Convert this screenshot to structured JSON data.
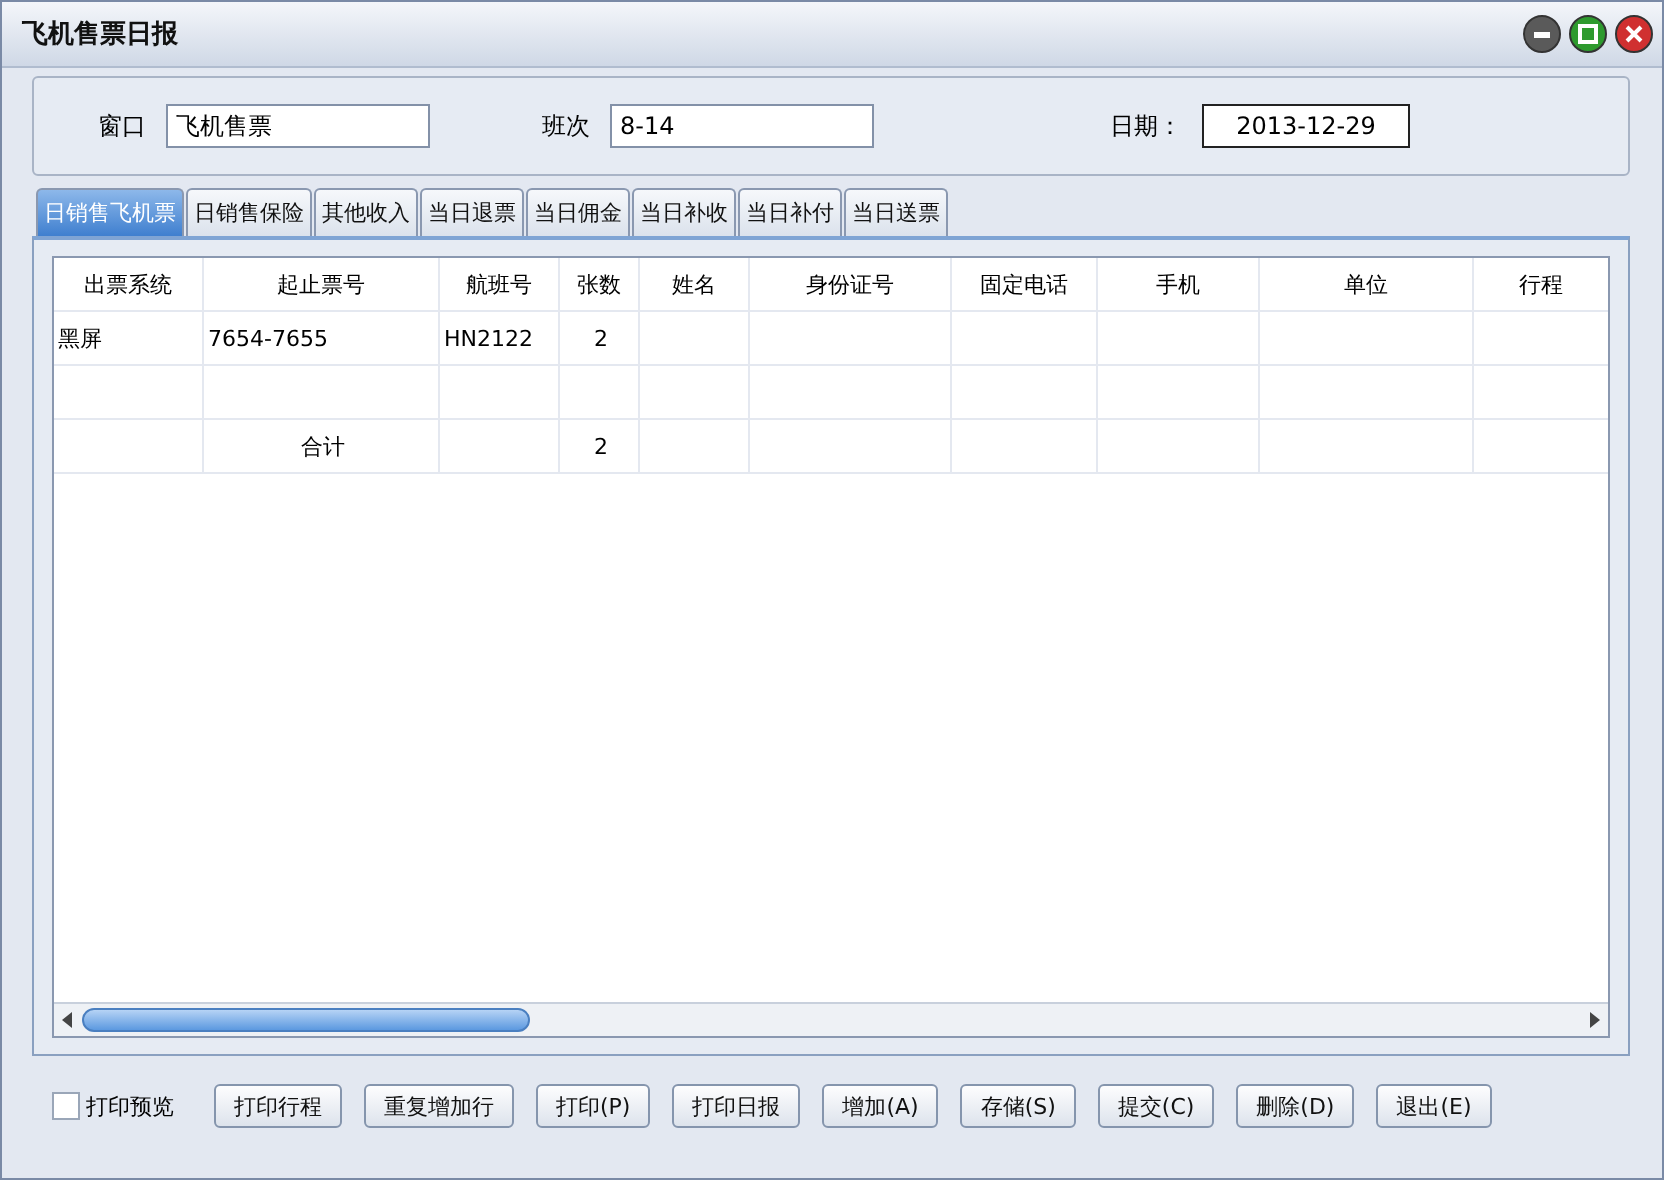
{
  "window": {
    "title": "飞机售票日报"
  },
  "fields": [
    {
      "label": "窗口",
      "value": "飞机售票",
      "kind": "input"
    },
    {
      "label": "班次",
      "value": "8-14",
      "kind": "input"
    },
    {
      "label": "日期：",
      "value": "2013-12-29",
      "kind": "date"
    }
  ],
  "tabs": [
    {
      "label": "日销售飞机票",
      "selected": true
    },
    {
      "label": "日销售保险",
      "selected": false
    },
    {
      "label": "其他收入",
      "selected": false
    },
    {
      "label": "当日退票",
      "selected": false
    },
    {
      "label": "当日佣金",
      "selected": false
    },
    {
      "label": "当日补收",
      "selected": false
    },
    {
      "label": "当日补付",
      "selected": false
    },
    {
      "label": "当日送票",
      "selected": false
    }
  ],
  "table": {
    "columns": [
      "出票系统",
      "起止票号",
      "航班号",
      "张数",
      "姓名",
      "身份证号",
      "固定电话",
      "手机",
      "单位",
      "行程"
    ],
    "rows": [
      [
        "黑屏",
        "7654-7655",
        "HN2122",
        "2",
        "",
        "",
        "",
        "",
        "",
        ""
      ],
      [
        "",
        "",
        "",
        "",
        "",
        "",
        "",
        "",
        "",
        ""
      ],
      [
        "",
        "合计",
        "",
        "2",
        "",
        "",
        "",
        "",
        "",
        ""
      ]
    ]
  },
  "print_preview": {
    "label": "打印预览",
    "checked": false
  },
  "buttons": [
    "打印行程",
    "重复增加行",
    "打印(P)",
    "打印日报",
    "增加(A)",
    "存储(S)",
    "提交(C)",
    "删除(D)",
    "退出(E)"
  ]
}
